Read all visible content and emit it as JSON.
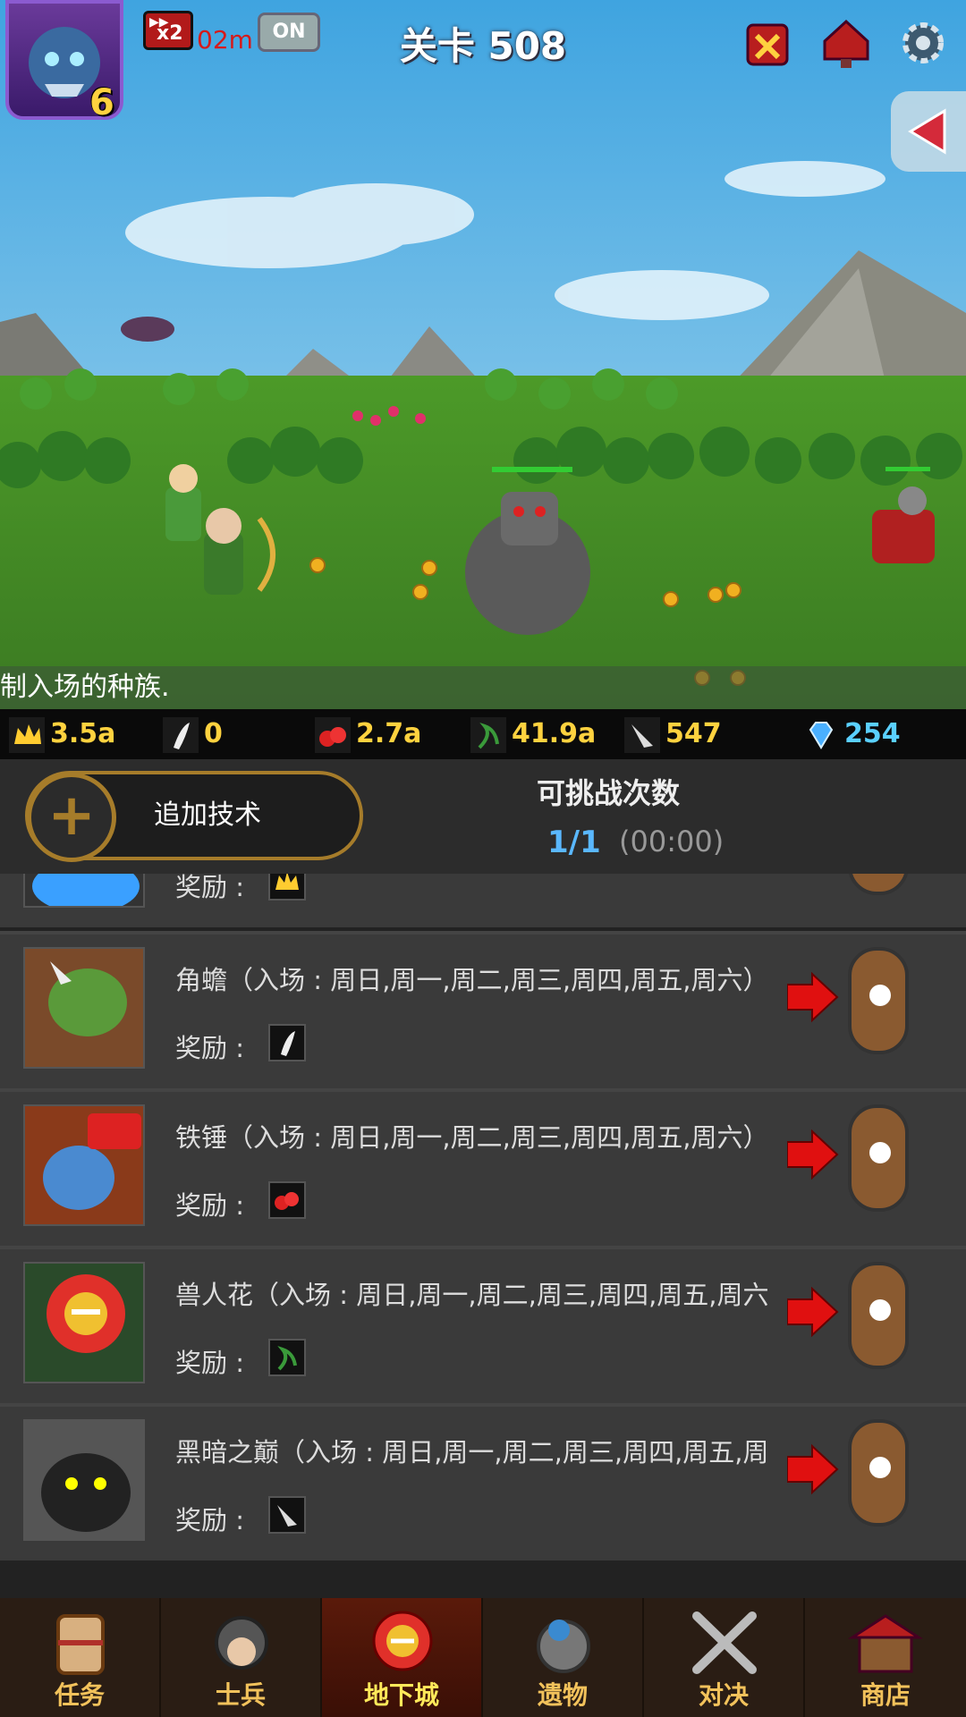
{
  "hud": {
    "hero_level": "6",
    "speed_label": "x2",
    "timer": "02m",
    "auto_toggle": "ON",
    "stage_title": "关卡 508",
    "icons": [
      "guild-banner-icon",
      "mailbox-icon",
      "gear-icon",
      "collapse-arrow-icon"
    ]
  },
  "battle": {
    "scroll_message": "制入场的种族."
  },
  "resources": [
    {
      "icon": "crown-icon",
      "value": "3.5a"
    },
    {
      "icon": "horn-icon",
      "value": "0"
    },
    {
      "icon": "red-gem-icon",
      "value": "2.7a"
    },
    {
      "icon": "vine-icon",
      "value": "41.9a"
    },
    {
      "icon": "fang-icon",
      "value": "547"
    },
    {
      "icon": "diamond-icon",
      "value": "254"
    }
  ],
  "panel": {
    "add_tech_label": "追加技术",
    "challenge_title": "可挑战次数",
    "challenge_count": "1/1",
    "challenge_time": "(00:00)"
  },
  "dungeons": [
    {
      "name": "",
      "reward_label": "奖励 :",
      "reward_icon": "crown-icon",
      "color": "#3aa0ff"
    },
    {
      "name": "角蟾（入场 : 周日,周一,周二,周三,周四,周五,周六）",
      "reward_label": "奖励 :",
      "reward_icon": "horn-icon",
      "color": "#5a9a3a"
    },
    {
      "name": "铁锤（入场 : 周日,周一,周二,周三,周四,周五,周六）",
      "reward_label": "奖励 :",
      "reward_icon": "red-gem-icon",
      "color": "#4a8ad0"
    },
    {
      "name": "兽人花（入场 : 周日,周一,周二,周三,周四,周五,周六",
      "reward_label": "奖励 :",
      "reward_icon": "vine-icon",
      "color": "#e0302a"
    },
    {
      "name": "黑暗之巅（入场 : 周日,周一,周二,周三,周四,周五,周",
      "reward_label": "奖励 :",
      "reward_icon": "fang-icon",
      "color": "#222222"
    }
  ],
  "nav": [
    {
      "label": "任务",
      "icon": "scroll-icon"
    },
    {
      "label": "士兵",
      "icon": "helmet-icon"
    },
    {
      "label": "地下城",
      "icon": "dungeon-flower-icon",
      "active": true
    },
    {
      "label": "遗物",
      "icon": "relic-orb-icon"
    },
    {
      "label": "对决",
      "icon": "crossed-swords-icon"
    },
    {
      "label": "商店",
      "icon": "shop-icon"
    }
  ]
}
